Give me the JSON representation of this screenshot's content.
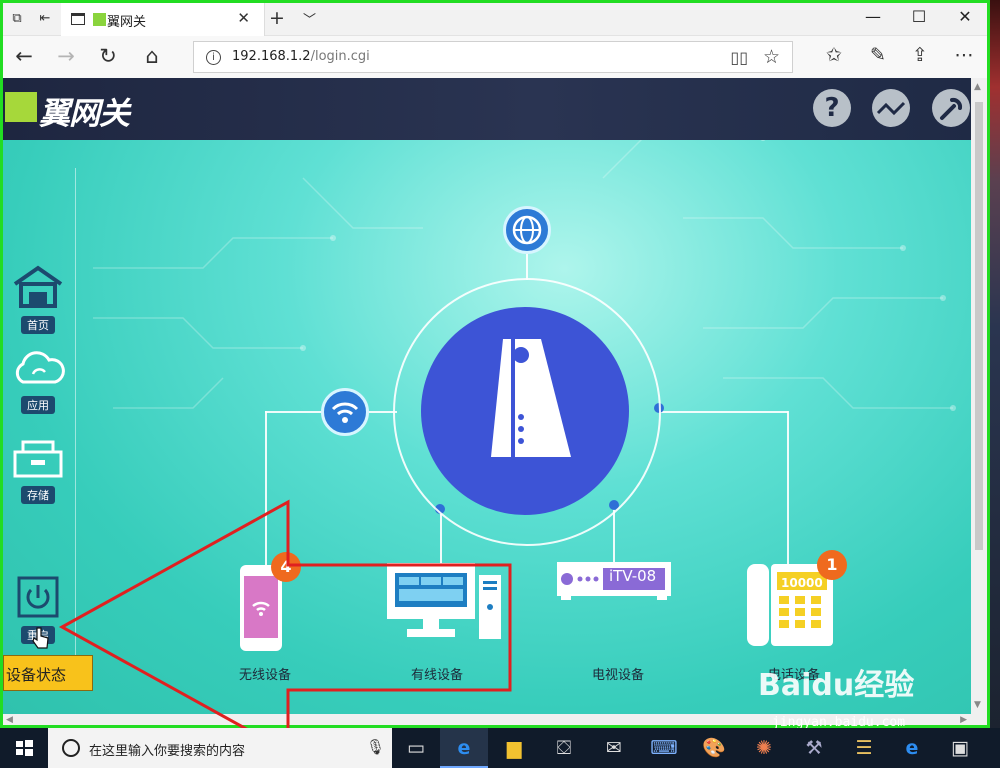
{
  "browser": {
    "tab_title": "翼网关",
    "url_host": "192.168.1.2",
    "url_path": "/login.cgi"
  },
  "page": {
    "logo_text": "翼网关",
    "sidebar": [
      {
        "label": "首页",
        "icon": "home-icon"
      },
      {
        "label": "应用",
        "icon": "cloud-icon"
      },
      {
        "label": "存储",
        "icon": "storage-icon"
      },
      {
        "label": "重启",
        "icon": "power-icon"
      }
    ],
    "devices": [
      {
        "label": "无线设备",
        "badge": "4"
      },
      {
        "label": "有线设备"
      },
      {
        "label": "电视设备",
        "screen_text": "iTV-08"
      },
      {
        "label": "电话设备",
        "badge": "1",
        "phone_number": "10000"
      }
    ],
    "status_tag": "设备状态"
  },
  "taskbar": {
    "search_placeholder": "在这里输入你要搜索的内容"
  },
  "watermark": {
    "brand": "Baidu经验",
    "domain": "jingyan.baidu.com"
  },
  "colors": {
    "highlight_border": "#22dd22",
    "annotation_red": "#e02020",
    "hub_blue": "#3d54d6",
    "badge_orange": "#ef6a1e",
    "header_navy": "#1e2640"
  }
}
